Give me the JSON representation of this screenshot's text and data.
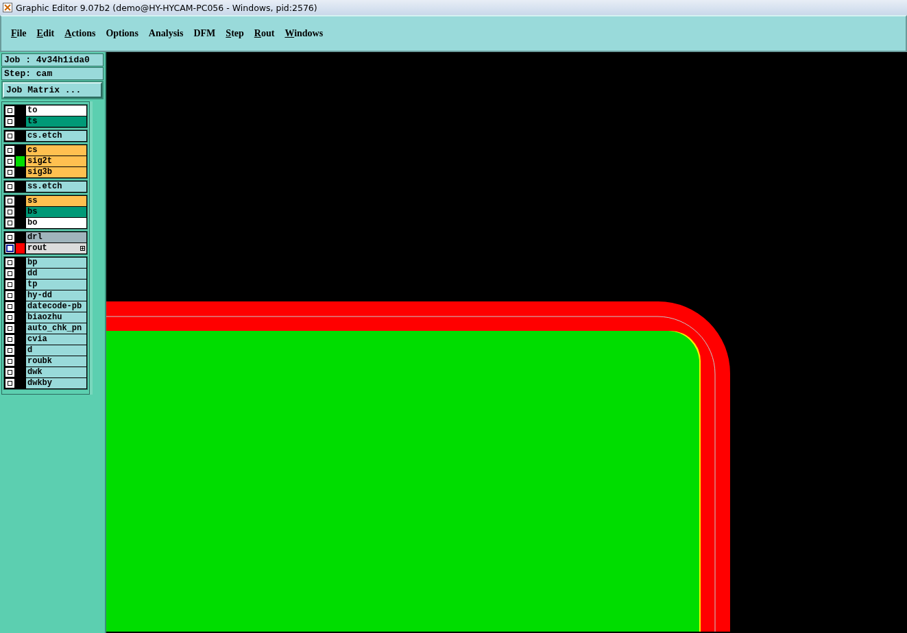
{
  "window": {
    "title": "Graphic Editor 9.07b2 (demo@HY-HYCAM-PC056 - Windows, pid:2576)"
  },
  "menu": [
    {
      "label": "File",
      "mnemonic": true
    },
    {
      "label": "Edit",
      "mnemonic": true
    },
    {
      "label": "Actions",
      "mnemonic": true
    },
    {
      "label": "Options",
      "mnemonic": false
    },
    {
      "label": "Analysis",
      "mnemonic": false
    },
    {
      "label": "DFM",
      "mnemonic": false
    },
    {
      "label": "Step",
      "mnemonic": true
    },
    {
      "label": "Rout",
      "mnemonic": true
    },
    {
      "label": "Windows",
      "mnemonic": true
    }
  ],
  "job": "Job : 4v34h1ida0",
  "step": "Step: cam",
  "job_matrix_button": "Job Matrix ...",
  "layer_groups": [
    {
      "layers": [
        {
          "name": "to",
          "color": "#ffffff",
          "selected": false
        },
        {
          "name": "ts",
          "color": "#009977",
          "selected": false
        }
      ]
    },
    {
      "layers": [
        {
          "name": "cs.etch",
          "color": "#99dada",
          "selected": false
        }
      ]
    },
    {
      "layers": [
        {
          "name": "cs",
          "color": "#ffc050",
          "selected": false
        },
        {
          "name": "sig2t",
          "color": "#ffc050",
          "selected": false,
          "swatch": {
            "color": "#00dd00"
          }
        },
        {
          "name": "sig3b",
          "color": "#ffc050",
          "selected": false
        }
      ]
    },
    {
      "layers": [
        {
          "name": "ss.etch",
          "color": "#99dada",
          "selected": false
        }
      ]
    },
    {
      "layers": [
        {
          "name": "ss",
          "color": "#ffc050",
          "selected": false
        },
        {
          "name": "bs",
          "color": "#009977",
          "selected": false
        },
        {
          "name": "bo",
          "color": "#ffffff",
          "selected": false
        }
      ]
    },
    {
      "layers": [
        {
          "name": "drl",
          "color": "#a0b4bc",
          "selected": false
        },
        {
          "name": "rout",
          "color": "#dcdcdc",
          "selected": true,
          "swatch": {
            "color": "#ff0000"
          },
          "work": true
        }
      ]
    },
    {
      "layers": [
        {
          "name": "bp",
          "color": "#99dada",
          "selected": false
        },
        {
          "name": "dd",
          "color": "#99dada",
          "selected": false
        },
        {
          "name": "tp",
          "color": "#99dada",
          "selected": false
        },
        {
          "name": "hy-dd",
          "color": "#99dada",
          "selected": false
        },
        {
          "name": "datecode-pb",
          "color": "#99dada",
          "selected": false
        },
        {
          "name": "biaozhu",
          "color": "#99dada",
          "selected": false
        },
        {
          "name": "auto_chk_pn",
          "color": "#99dada",
          "selected": false
        },
        {
          "name": "cvia",
          "color": "#99dada",
          "selected": false
        },
        {
          "name": "d",
          "color": "#99dada",
          "selected": false
        },
        {
          "name": "roubk",
          "color": "#99dada",
          "selected": false
        },
        {
          "name": "dwk",
          "color": "#99dada",
          "selected": false
        },
        {
          "name": "dwkby",
          "color": "#99dada",
          "selected": false
        }
      ]
    }
  ]
}
